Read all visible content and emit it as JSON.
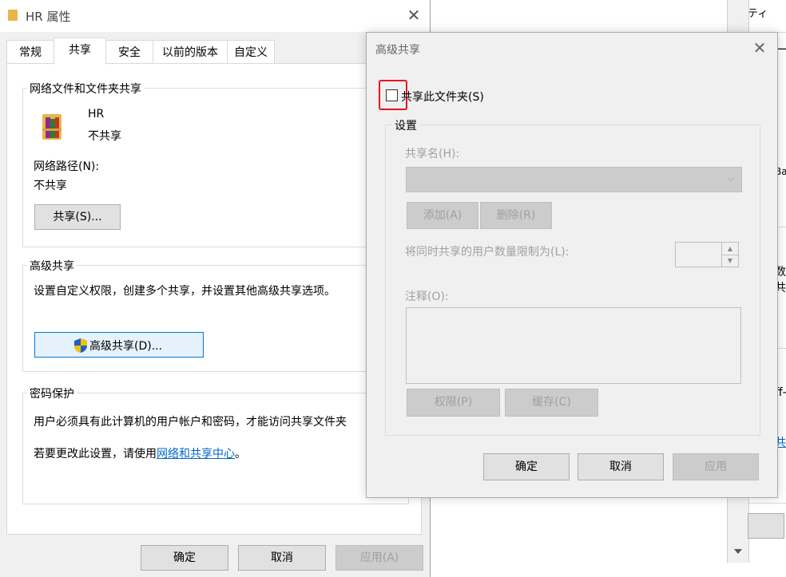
{
  "background_window": {
    "fragments": [
      "ティ",
      "ー",
      "Ba",
      "数",
      "共",
      "ff-",
      "共"
    ]
  },
  "props_dialog": {
    "title": "HR 属性",
    "tabs": [
      "常规",
      "共享",
      "安全",
      "以前的版本",
      "自定义"
    ],
    "active_tab": "共享",
    "network_share": {
      "group_title": "网络文件和文件夹共享",
      "folder_name": "HR",
      "folder_status": "不共享",
      "path_label": "网络路径(N):",
      "path_value": "不共享",
      "share_button": "共享(S)..."
    },
    "advanced": {
      "group_title": "高级共享",
      "description": "设置自定义权限，创建多个共享，并设置其他高级共享选项。",
      "button": "高级共享(D)..."
    },
    "password": {
      "group_title": "密码保护",
      "description": "用户必须具有此计算机的用户帐户和密码，才能访问共享文件夹",
      "change_prefix": "若要更改此设置，请使用",
      "change_link": "网络和共享中心",
      "change_suffix": "。"
    },
    "buttons": {
      "ok": "确定",
      "cancel": "取消",
      "apply": "应用(A)"
    }
  },
  "advanced_dialog": {
    "title": "高级共享",
    "share_checkbox_label": "共享此文件夹(S)",
    "share_checked": false,
    "settings_group": "设置",
    "share_name_label": "共享名(H):",
    "add_button": "添加(A)",
    "remove_button": "删除(R)",
    "limit_label": "将同时共享的用户数量限制为(L):",
    "comment_label": "注释(O):",
    "permissions_button": "权限(P)",
    "caching_button": "缓存(C)",
    "buttons": {
      "ok": "确定",
      "cancel": "取消",
      "apply": "应用"
    },
    "highlight_color": "#e81123"
  }
}
